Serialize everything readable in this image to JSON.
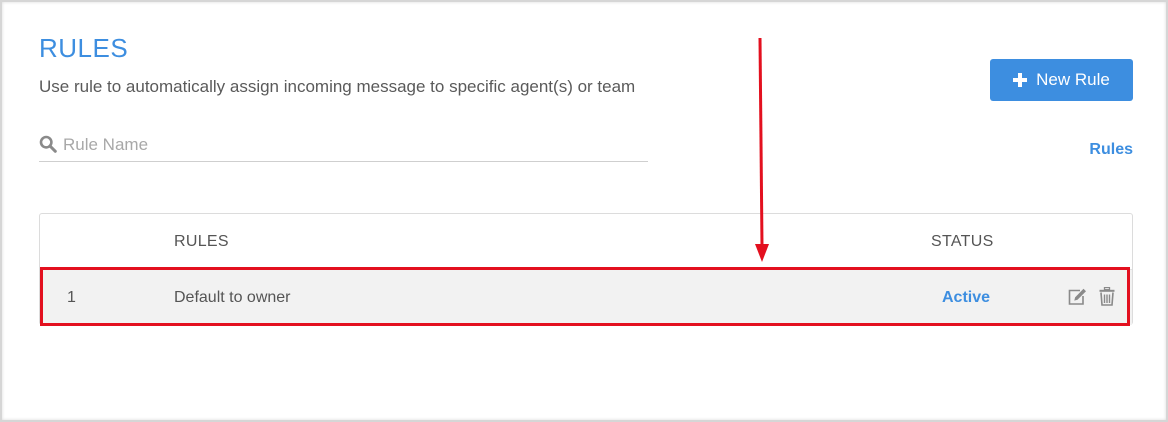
{
  "header": {
    "title": "RULES",
    "description": "Use rule to automatically assign incoming message to specific agent(s) or team"
  },
  "toolbar": {
    "new_rule_label": "New Rule",
    "new_rule_icon": "plus-icon"
  },
  "search": {
    "placeholder": "Rule Name",
    "value": "",
    "icon": "search-icon"
  },
  "rules_link": "Rules",
  "table": {
    "columns": [
      "",
      "RULES",
      "STATUS"
    ],
    "rows": [
      {
        "number": "1",
        "name": "Default to owner",
        "status": "Active",
        "actions": [
          "edit-icon",
          "trash-icon"
        ]
      }
    ]
  },
  "colors": {
    "accent": "#3d8ee0",
    "annotation": "#e3101f",
    "row_background": "#f2f2f2"
  }
}
